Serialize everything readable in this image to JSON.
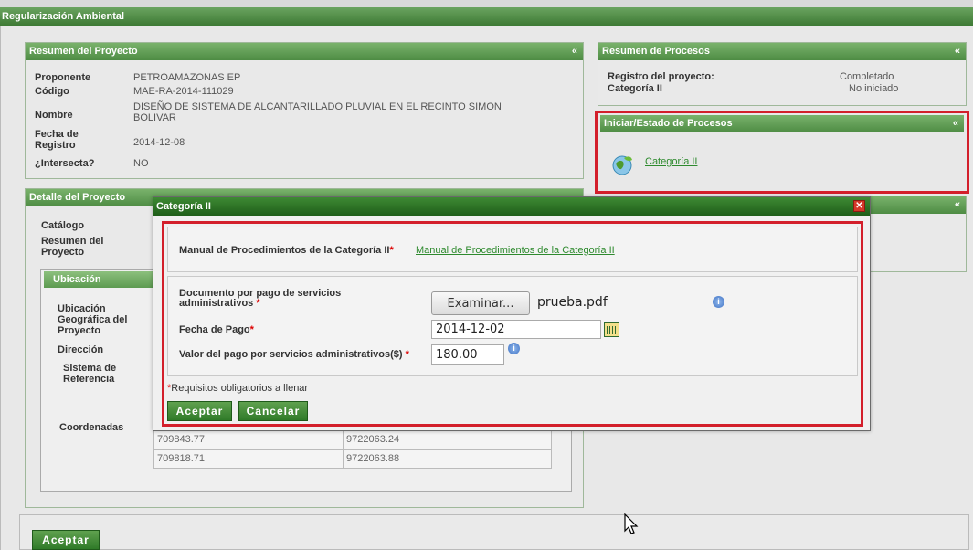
{
  "app": {
    "title": "Regularización Ambiental"
  },
  "resumen_proyecto": {
    "title": "Resumen del Proyecto",
    "collapse": "«",
    "rows": [
      {
        "label": "Proponente",
        "value": "PETROAMAZONAS EP"
      },
      {
        "label": "Código",
        "value": "MAE-RA-2014-111029"
      },
      {
        "label": "Nombre",
        "value": "DISEÑO DE SISTEMA DE ALCANTARILLADO PLUVIAL EN EL RECINTO SIMON BOLIVAR"
      },
      {
        "label": "Fecha de Registro",
        "value": "2014-12-08"
      },
      {
        "label": "¿Intersecta?",
        "value": "NO"
      }
    ]
  },
  "resumen_procesos": {
    "title": "Resumen de Procesos",
    "collapse": "«",
    "rows": [
      {
        "label": "Registro del proyecto:",
        "value": "Completado"
      },
      {
        "label": "Categoría II",
        "value": "No iniciado"
      }
    ]
  },
  "iniciar_procesos": {
    "title": "Iniciar/Estado de Procesos",
    "collapse": "«",
    "link": "Categoría II"
  },
  "detalle_proyecto": {
    "title": "Detalle del Proyecto",
    "catalogo_label": "Catálogo",
    "resumen_label": "Resumen del Proyecto",
    "ubicacion": {
      "title": "Ubicación",
      "geo_label": "Ubicación Geográfica del Proyecto",
      "direccion_label": "Dirección",
      "sistema_label": "Sistema de Referencia",
      "coordenadas_label": "Coordenadas",
      "coords": [
        {
          "x": "709843.77",
          "y": "9722063.24"
        },
        {
          "x": "709818.71",
          "y": "9722063.88"
        }
      ]
    }
  },
  "right_panel3": {
    "collapse": "«"
  },
  "dialog": {
    "title": "Categoría II",
    "manual_label": "Manual de Procedimientos de la Categoría II",
    "manual_link": "Manual de Procedimientos de la Categoría II",
    "doc_label": "Documento por pago de servicios administrativos",
    "browse_button": "Examinar...",
    "file_name": "prueba.pdf",
    "fecha_label": "Fecha de Pago",
    "fecha_value": "2014-12-02",
    "valor_label": "Valor del pago por servicios administrativos($)",
    "valor_value": "180.00",
    "required_note": "Requisitos obligatorios a llenar",
    "accept": "Aceptar",
    "cancel": "Cancelar",
    "asterisk": "*"
  },
  "footer": {
    "accept": "Aceptar"
  }
}
